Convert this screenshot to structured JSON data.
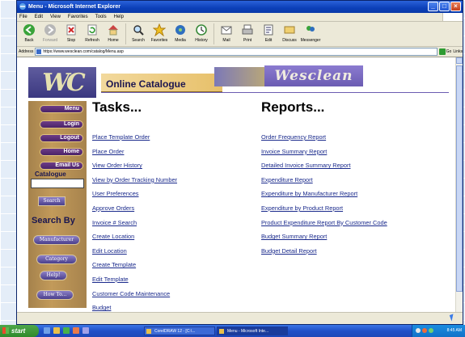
{
  "window": {
    "title": "Menu - Microsoft Internet Explorer",
    "menus": [
      "File",
      "Edit",
      "View",
      "Favorites",
      "Tools",
      "Help"
    ]
  },
  "toolbar": {
    "buttons": [
      {
        "label": "Back",
        "icon": "back-arrow-icon"
      },
      {
        "label": "Forward",
        "icon": "forward-arrow-icon"
      },
      {
        "label": "Stop",
        "icon": "stop-icon"
      },
      {
        "label": "Refresh",
        "icon": "refresh-icon"
      },
      {
        "label": "Home",
        "icon": "home-icon"
      },
      {
        "label": "Search",
        "icon": "search-icon"
      },
      {
        "label": "Favorites",
        "icon": "star-icon"
      },
      {
        "label": "Media",
        "icon": "media-icon"
      },
      {
        "label": "History",
        "icon": "history-icon"
      },
      {
        "label": "Mail",
        "icon": "mail-icon"
      },
      {
        "label": "Print",
        "icon": "print-icon"
      },
      {
        "label": "Edit",
        "icon": "edit-icon"
      },
      {
        "label": "Discuss",
        "icon": "discuss-icon"
      },
      {
        "label": "Messenger",
        "icon": "messenger-icon"
      }
    ]
  },
  "address": {
    "label": "Address",
    "url": "https://www.wesclean.com/catalog/Menu.asp",
    "go": "Go",
    "links": "Links"
  },
  "header": {
    "logo_text": "WC",
    "section_title": "Online Catalogue",
    "brand_name": "Wesclean"
  },
  "sidebar": {
    "nav": [
      "Menu",
      "Login",
      "Logout",
      "Home",
      "Email Us"
    ],
    "catalogue_label": "Catalogue",
    "search_button": "Search",
    "search_by_label": "Search By",
    "search_by_buttons": [
      "Manufacturer",
      "Category"
    ],
    "help_button": "Help!",
    "howto_button": "How To..."
  },
  "tasks": {
    "heading": "Tasks...",
    "links": [
      "Place Template Order",
      "Place Order",
      "View Order History",
      "View by Order Tracking Number",
      "User Preferences",
      "Approve Orders",
      "Invoice # Search",
      "Create Location",
      "Edit Location",
      "Create Template",
      "Edit Template",
      "Customer Code Maintenance",
      "Budget"
    ]
  },
  "reports": {
    "heading": "Reports...",
    "links": [
      "Order Frequency Report",
      "Invoice Summary Report",
      "Detailed Invoice Summary Report",
      "Expenditure Report",
      "Expenditure by Manufacturer Report",
      "Expenditure by Product Report",
      "Product Expenditure Report By Customer Code",
      "Budget Summary Report",
      "Budget Detail Report"
    ]
  },
  "taskbar": {
    "start": "start",
    "items": [
      "CorelDRAW 12 - [C:\\...",
      "Menu - Microsoft Inte..."
    ],
    "clock": "8:45 AM"
  }
}
